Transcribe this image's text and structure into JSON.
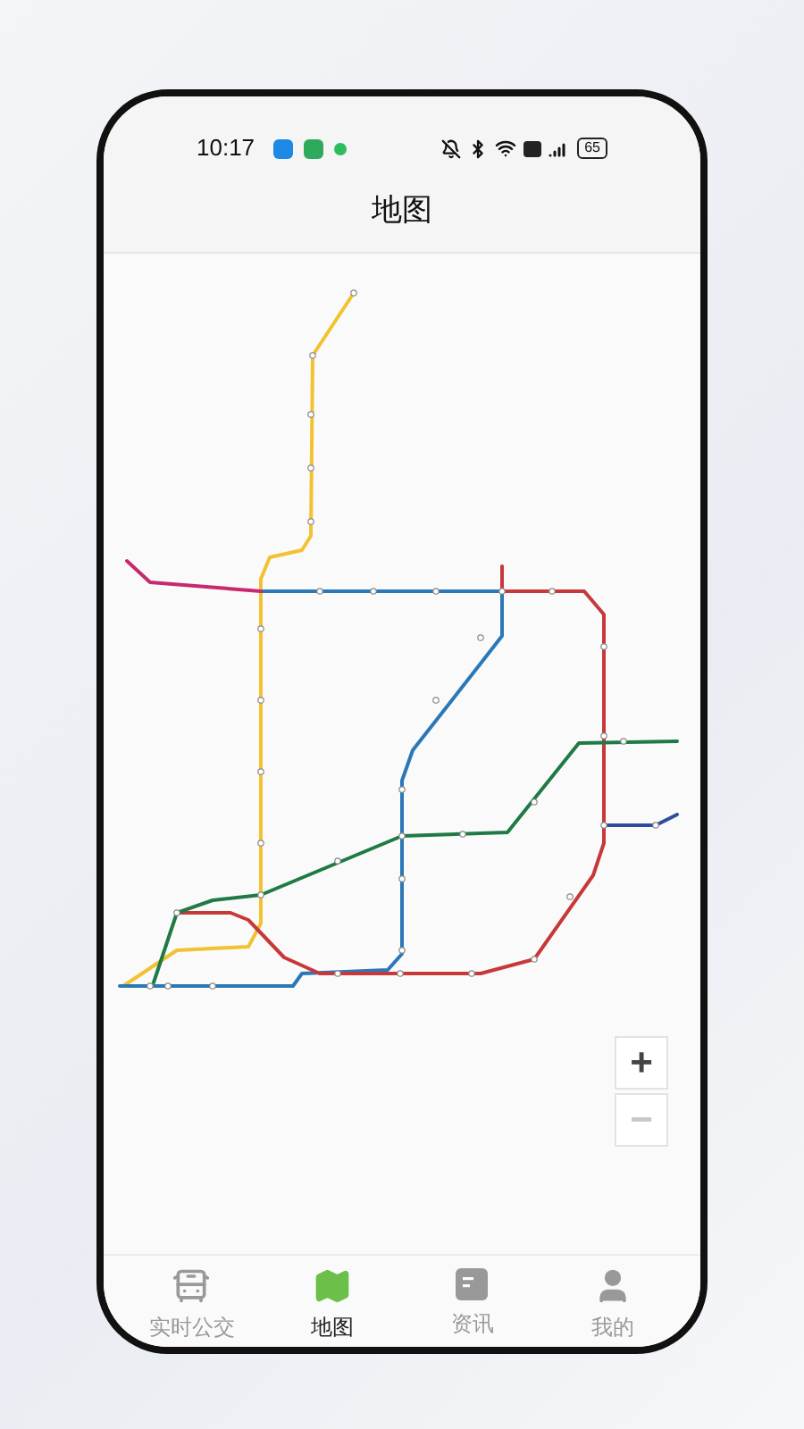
{
  "status_bar": {
    "time": "10:17",
    "battery": "65"
  },
  "header": {
    "title": "地图"
  },
  "zoom_controls": [
    {
      "label": "+",
      "disabled": false
    },
    {
      "label": "−",
      "disabled": true
    }
  ],
  "bottom_nav": [
    {
      "label": "实时公交",
      "selected": false
    },
    {
      "label": "地图",
      "selected": true
    },
    {
      "label": "资讯",
      "selected": false
    },
    {
      "label": "我的",
      "selected": false
    }
  ]
}
